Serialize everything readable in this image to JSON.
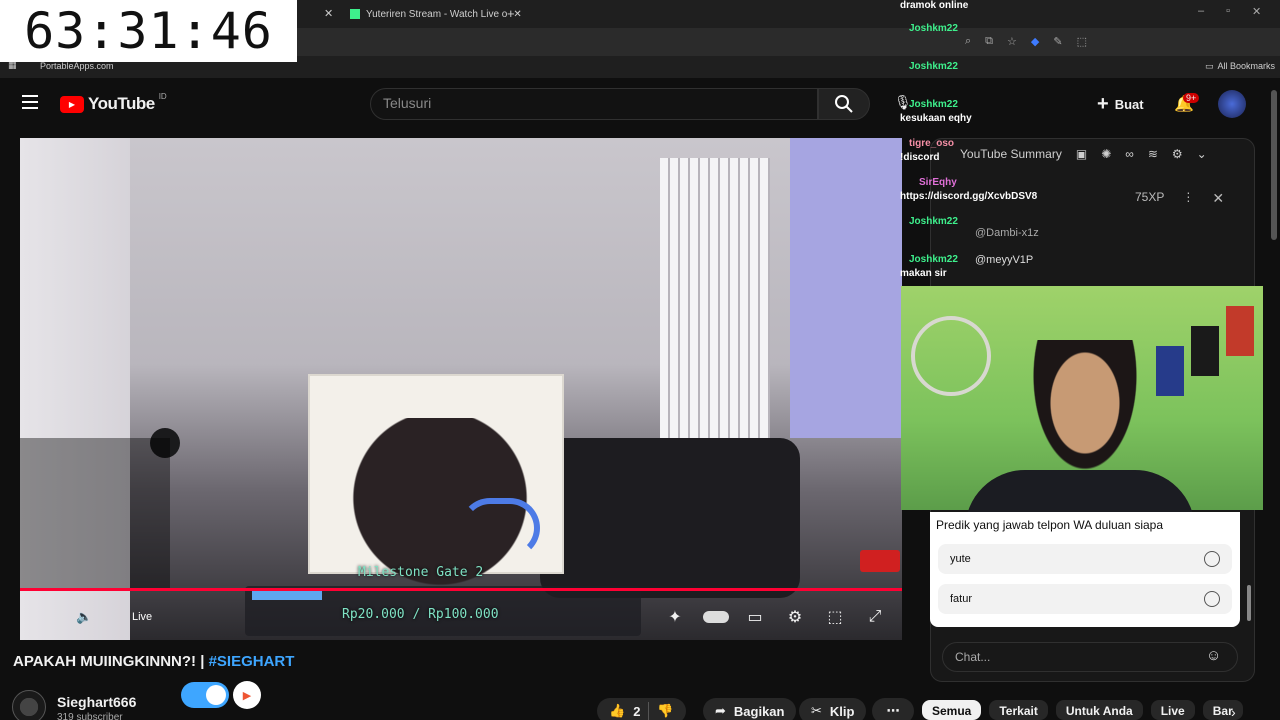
{
  "clock": "63:31:46",
  "browser": {
    "tab_title": "Yuteriren Stream - Watch Live o",
    "bookmark": "PortableApps.com",
    "all_bookmarks": "All Bookmarks"
  },
  "header": {
    "logo": "YouTube",
    "logo_region": "ID",
    "search_placeholder": "Telusuri",
    "create_label": "Buat",
    "notif_count": "9+"
  },
  "video": {
    "milestone": "Milestone Gate 2",
    "donation": "Rp20.000 / Rp100.000",
    "live_label": "Live",
    "progress": 1.0
  },
  "meta": {
    "title": "APAKAH MUIINGKINNN?! |",
    "hashtag": "#SIEGHART",
    "channel": "Sieghart666",
    "subs": "319 subscriber",
    "likes": "2",
    "share": "Bagikan",
    "clip": "Klip"
  },
  "chat_overlay": [
    {
      "name": "dramok online",
      "text": ""
    },
    {
      "name": "Joshkm22",
      "text": ""
    },
    {
      "name": "Joshkm22",
      "text": ""
    },
    {
      "name": "Joshkm22",
      "text": "kesukaan eqhy"
    },
    {
      "name": "tigre_oso",
      "text": "!discord"
    },
    {
      "name": "SirEqhy",
      "text": "https://discord.gg/XcvbDSV8"
    },
    {
      "name": "Joshkm22",
      "text": ""
    },
    {
      "name": "Joshkm22",
      "text": "makan sir"
    }
  ],
  "panel": {
    "summary": "YouTube Summary",
    "xp": "75XP",
    "mention1": "@Dambi-x1z",
    "mention2": "@meyyV1P"
  },
  "poll": {
    "question": "Predik yang jawab telpon WA duluan siapa",
    "options": [
      "yute",
      "fatur"
    ]
  },
  "chat_placeholder": "Chat...",
  "chips": [
    "Semua",
    "Terkait",
    "Untuk Anda",
    "Live",
    "Bar"
  ],
  "colors": {
    "accent": "#ff0033",
    "link": "#3ea6ff",
    "chat_name": "#3ef08c"
  }
}
